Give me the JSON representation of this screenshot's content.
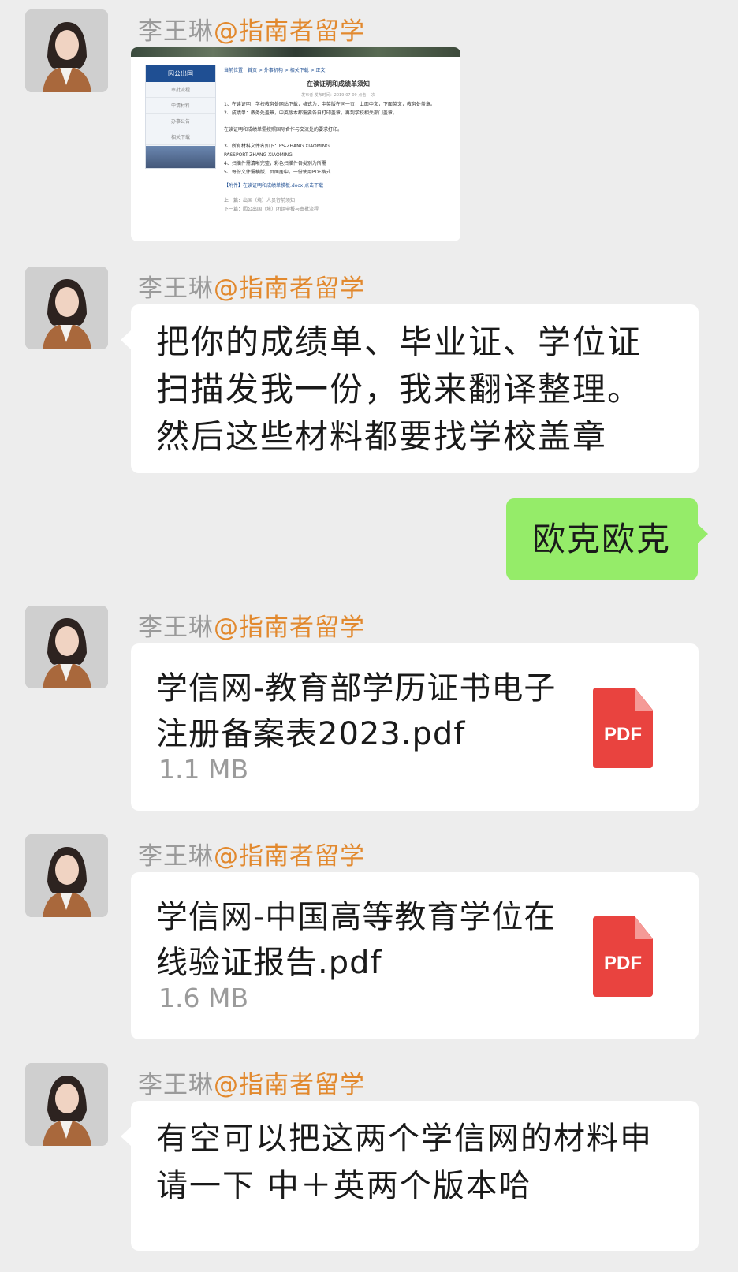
{
  "sender": {
    "name": "李王琳",
    "org": "@指南者留学"
  },
  "messages": [
    {
      "type": "image",
      "preview": {
        "nav_title": "因公出国",
        "nav_items": [
          "审批流程",
          "申请材料",
          "办事公告",
          "相关下载"
        ],
        "breadcrumb": "当前位置：首页 > 外事机构 > 相关下载 > 正文",
        "doc_title": "在读证明和成绩单须知",
        "meta": "发布者   发布时间：2019-07-09   点击：   次",
        "lines": [
          "1、在读证明：学校教务处网站下载，格式为：中英版在同一页，上面中文，下面英文，教务处盖章。",
          "2、成绩单：教务处盖章，中英版本都需要各自打印盖章，再到学校相关部门盖章。",
          "在读证明和成绩单需按照国际合作与交流处的要求打印。",
          "3、所有材料文件名如下：PS-ZHANG XIAOMING",
          "PASSPORT-ZHANG XIAOMING",
          "4、扫描件需清晰完整，彩色扫描件各类别为所需",
          "5、每份文件需横版，页面居中，一份使用PDF格式",
          "【附件】在读证明和成绩单模板.docx  点击下载",
          "上一篇：出国（境）人员行前须知",
          "下一篇：因公出国（境）团组申报与审批流程"
        ]
      }
    },
    {
      "type": "text",
      "text": "把你的成绩单、毕业证、学位证扫描发我一份，我来翻译整理。然后这些材料都要找学校盖章"
    },
    {
      "type": "text_out",
      "text": "欧克欧克"
    },
    {
      "type": "file",
      "name": "学信网-教育部学历证书电子注册备案表2023.pdf",
      "size": "1.1 MB",
      "icon": "pdf-icon",
      "icon_label": "PDF"
    },
    {
      "type": "file",
      "name": "学信网-中国高等教育学位在线验证报告.pdf",
      "size": "1.6 MB",
      "icon": "pdf-icon",
      "icon_label": "PDF"
    },
    {
      "type": "text",
      "text": "有空可以把这两个学信网的材料申请一下 中＋英两个版本哈"
    }
  ],
  "colors": {
    "incoming_bubble": "#ffffff",
    "outgoing_bubble": "#95ec69",
    "org_name": "#e2892e",
    "background": "#ededed",
    "pdf": "#e9433f"
  }
}
